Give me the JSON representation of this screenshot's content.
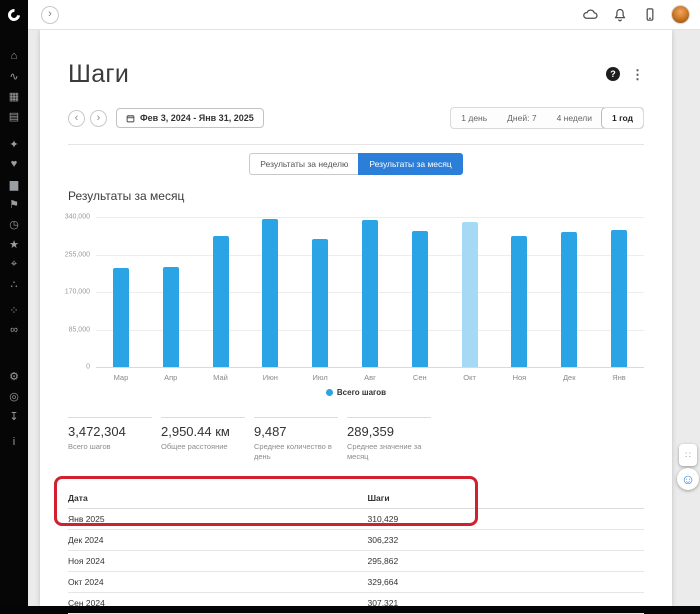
{
  "topbar": {
    "expand_icon": "›"
  },
  "sidebar": {
    "icons": [
      {
        "name": "home-icon",
        "glyph": "⌂",
        "gap": 8
      },
      {
        "name": "activities-icon",
        "glyph": "∿"
      },
      {
        "name": "calendar-icon",
        "glyph": "▦"
      },
      {
        "name": "reports-icon",
        "glyph": "▤"
      },
      {
        "name": "training-icon",
        "glyph": "✦",
        "gap": 8
      },
      {
        "name": "health-stats-icon",
        "glyph": "♥"
      },
      {
        "name": "performance-icon",
        "glyph": "▆"
      },
      {
        "name": "training-plans-icon",
        "glyph": "⚑"
      },
      {
        "name": "watch-icon",
        "glyph": "◷"
      },
      {
        "name": "challenges-icon",
        "glyph": "★"
      },
      {
        "name": "courses-icon",
        "glyph": "⌖"
      },
      {
        "name": "insights-icon",
        "glyph": "∴"
      },
      {
        "name": "groups-icon",
        "glyph": "⁘",
        "gap": 6
      },
      {
        "name": "connections-icon",
        "glyph": "∞"
      },
      {
        "name": "settings-icon",
        "glyph": "⚙",
        "gap": 26
      },
      {
        "name": "badges-icon",
        "glyph": "◎"
      },
      {
        "name": "downloads-icon",
        "glyph": "↧"
      },
      {
        "name": "info-icon",
        "glyph": "i",
        "gap": 6
      }
    ]
  },
  "page": {
    "title": "Шаги",
    "help_icon": "?",
    "menu_icon": "⋮"
  },
  "controls": {
    "prev_icon": "‹",
    "next_icon": "›",
    "date_range": "Фев 3, 2024 - Янв 31, 2025",
    "ranges": [
      "1 день",
      "Дней: 7",
      "4 недели",
      "1 год"
    ],
    "selected_range": "1 год"
  },
  "tabs": {
    "items": [
      "Результаты за неделю",
      "Результаты за месяц"
    ],
    "selected": "Результаты за месяц"
  },
  "section_title": "Результаты за месяц",
  "chart_data": {
    "type": "bar",
    "title": "Результаты за месяц",
    "categories": [
      "Мар",
      "Апр",
      "Май",
      "Июн",
      "Июл",
      "Авг",
      "Сен",
      "Окт",
      "Ноя",
      "Дек",
      "Янв"
    ],
    "values": [
      224000,
      226000,
      298000,
      336000,
      291000,
      333000,
      307321,
      329664,
      295862,
      306232,
      310429
    ],
    "highlight_index": 7,
    "yticks": [
      "0",
      "85,000",
      "170,000",
      "255,000",
      "340,000"
    ],
    "ylim": [
      0,
      340000
    ],
    "xlabel": "",
    "ylabel": "",
    "grid": true,
    "legend": "Всего шагов",
    "legend_position": "bottom",
    "bar_color": "#2aa4e5",
    "highlight_color": "#a6d9f4"
  },
  "stats": [
    {
      "value": "3,472,304",
      "label": "Всего шагов"
    },
    {
      "value": "2,950.44 км",
      "label": "Общее расстояние"
    },
    {
      "value": "9,487",
      "label": "Среднее количество в день"
    },
    {
      "value": "289,359",
      "label": "Среднее значение за месяц"
    }
  ],
  "table": {
    "headers": [
      "Дата",
      "Шаги"
    ],
    "rows": [
      [
        "Янв 2025",
        "310,429"
      ],
      [
        "Дек 2024",
        "306,232"
      ],
      [
        "Ноя 2024",
        "295,862"
      ],
      [
        "Окт 2024",
        "329,664"
      ],
      [
        "Сен 2024",
        "307,321"
      ]
    ]
  },
  "widgets": {
    "handle_icon": "∷",
    "feedback_icon": "☺"
  },
  "colors": {
    "accent_blue": "#2b7fd9",
    "bar_blue": "#2aa4e5",
    "bar_light": "#a6d9f4",
    "annotation_red": "#d2202e"
  }
}
